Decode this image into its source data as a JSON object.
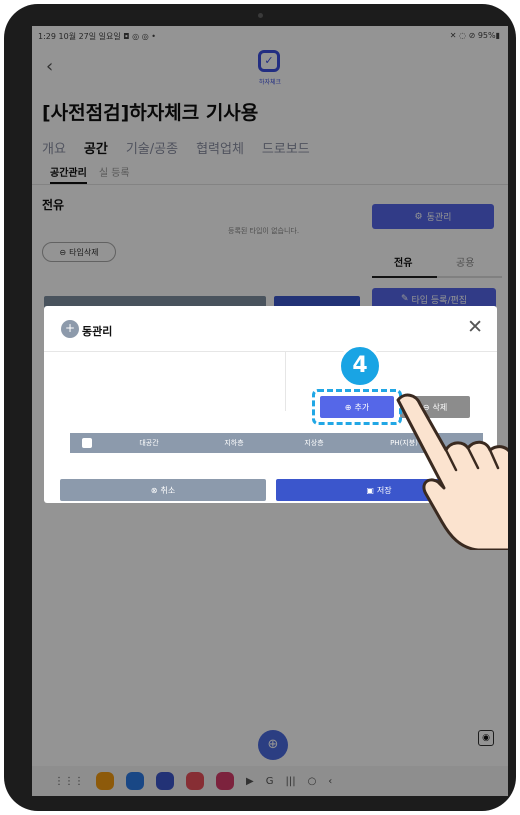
{
  "status_bar": {
    "left": "1:29  10월 27일 일요일  ◘ ◎ ◎ •",
    "right": "✕ ◌ ⊘ 95%▮"
  },
  "app": {
    "back_glyph": "‹",
    "logo_text": "하자체크"
  },
  "page": {
    "title": "[사전점검]하자체크 기사용",
    "tabs": [
      "개요",
      "공간",
      "기술/공종",
      "협력업체",
      "드로보드"
    ],
    "active_tab": "공간",
    "subtabs": [
      "공간관리",
      "실 등록"
    ],
    "section_title": "전유",
    "empty_message": "등록된 타입이 없습니다.",
    "btn_dong_manage": "동관리",
    "btn_type_delete": "타입삭제",
    "right_tabs": [
      "전유",
      "공용"
    ],
    "btn_type_edit": "타입 등록/편집"
  },
  "modal": {
    "title": "동관리",
    "close_glyph": "✕",
    "btn_add": "추가",
    "btn_delete": "삭제",
    "step_number": "4",
    "table_headers": [
      "대공간",
      "지하층",
      "지상층",
      "PH(지붕)"
    ],
    "btn_cancel": "취소",
    "btn_save": "저장"
  },
  "fab_glyph": "⊕",
  "side_glyph": "◉",
  "colors": {
    "primary": "#5567e8",
    "dark_blue": "#3b56cc",
    "gray": "#8c9aac",
    "badge": "#19a4e4"
  },
  "icons": [
    "back-icon",
    "logo-icon",
    "settings-icon",
    "minus-circle-icon",
    "edit-icon",
    "plus-circle-icon",
    "close-icon",
    "cancel-icon",
    "save-icon",
    "hand-pointer-icon"
  ]
}
